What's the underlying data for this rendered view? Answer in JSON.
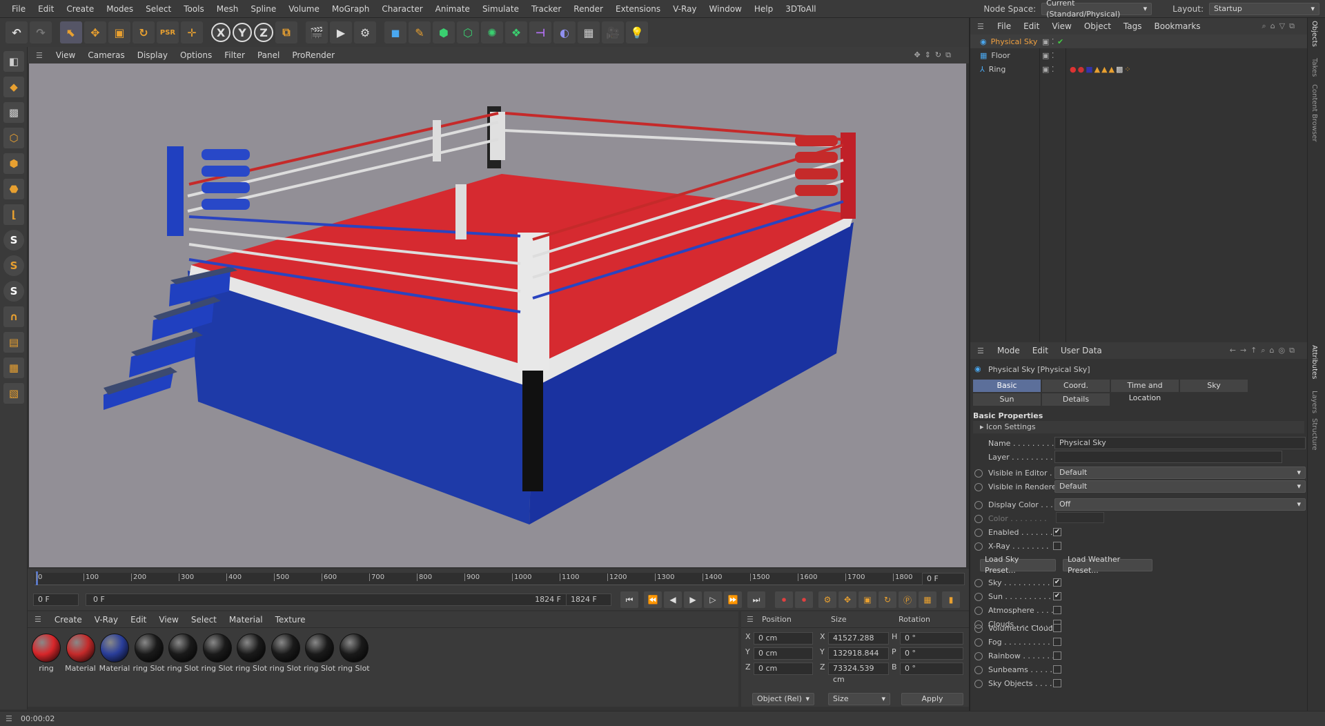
{
  "menubar": {
    "items": [
      "File",
      "Edit",
      "Create",
      "Modes",
      "Select",
      "Tools",
      "Mesh",
      "Spline",
      "Volume",
      "MoGraph",
      "Character",
      "Animate",
      "Simulate",
      "Tracker",
      "Render",
      "Extensions",
      "V-Ray",
      "Window",
      "Help",
      "3DToAll"
    ],
    "nodespace_label": "Node Space:",
    "nodespace_value": "Current (Standard/Physical)",
    "layout_label": "Layout:",
    "layout_value": "Startup"
  },
  "toolbar": {
    "axis_x": "X",
    "axis_y": "Y",
    "axis_z": "Z"
  },
  "viewport": {
    "menu": [
      "View",
      "Cameras",
      "Display",
      "Options",
      "Filter",
      "Panel",
      "ProRender"
    ]
  },
  "timeline": {
    "ticks": [
      "0",
      "100",
      "200",
      "300",
      "400",
      "500",
      "600",
      "700",
      "800",
      "900",
      "1000",
      "1100",
      "1200",
      "1300",
      "1400",
      "1500",
      "1600",
      "1700",
      "1800"
    ],
    "current": "0 F",
    "start": "0 F",
    "range_start": "0 F",
    "range_end": "1824 F",
    "end": "1824 F"
  },
  "materials": {
    "menu": [
      "Create",
      "V-Ray",
      "Edit",
      "View",
      "Select",
      "Material",
      "Texture"
    ],
    "items": [
      {
        "label": "ring",
        "color": "#d8262a"
      },
      {
        "label": "Material",
        "color": "#c52a2a"
      },
      {
        "label": "Material",
        "color": "#2a3e9a"
      },
      {
        "label": "ring Slot",
        "color": "#1a1a1a"
      },
      {
        "label": "ring Slot",
        "color": "#1a1a1a"
      },
      {
        "label": "ring Slot",
        "color": "#1a1a1a"
      },
      {
        "label": "ring Slot",
        "color": "#1a1a1a"
      },
      {
        "label": "ring Slot",
        "color": "#1a1a1a"
      },
      {
        "label": "ring Slot",
        "color": "#1a1a1a"
      },
      {
        "label": "ring Slot",
        "color": "#1a1a1a"
      }
    ]
  },
  "coords": {
    "h_position": "Position",
    "h_size": "Size",
    "h_rotation": "Rotation",
    "rows": [
      {
        "axis": "X",
        "pos": "0 cm",
        "saxis": "X",
        "size": "41527.288 cm",
        "raxis": "H",
        "rot": "0 °"
      },
      {
        "axis": "Y",
        "pos": "0 cm",
        "saxis": "Y",
        "size": "132918.844 cm",
        "raxis": "P",
        "rot": "0 °"
      },
      {
        "axis": "Z",
        "pos": "0 cm",
        "saxis": "Z",
        "size": "73324.539 cm",
        "raxis": "B",
        "rot": "0 °"
      }
    ],
    "mode": "Object (Rel)",
    "size_mode": "Size",
    "apply": "Apply"
  },
  "status": {
    "time": "00:00:02"
  },
  "objects": {
    "menu": [
      "File",
      "Edit",
      "View",
      "Object",
      "Tags",
      "Bookmarks"
    ],
    "items": [
      {
        "name": "Physical Sky"
      },
      {
        "name": "Floor"
      },
      {
        "name": "Ring"
      }
    ]
  },
  "attributes": {
    "menu": [
      "Mode",
      "Edit",
      "User Data"
    ],
    "title": "Physical Sky [Physical Sky]",
    "tabs": [
      "Basic",
      "Coord.",
      "Time and Location",
      "Sky",
      "Sun",
      "Details"
    ],
    "section": "Basic Properties",
    "icon_settings": "Icon Settings",
    "name_label": "Name . . . . . . . . .",
    "name_value": "Physical Sky",
    "layer_label": "Layer . . . . . . . . .",
    "vis_editor_label": "Visible in Editor . .",
    "vis_editor": "Default",
    "vis_render_label": "Visible in Renderer",
    "vis_render": "Default",
    "display_color_label": "Display Color . . . .",
    "display_color": "Off",
    "color_label": "Color . . . . . . . .",
    "enabled_label": "Enabled . . . . . . .",
    "xray_label": "X-Ray . . . . . . . .",
    "load_sky": "Load Sky Preset...",
    "load_weather": "Load Weather Preset...",
    "checks": [
      {
        "label": "Sky . . . . . . . . . .",
        "on": true
      },
      {
        "label": "Sun . . . . . . . . . .",
        "on": true
      },
      {
        "label": "Atmosphere . . . .",
        "on": false
      },
      {
        "label": "Clouds . . . . . . . .",
        "on": false
      },
      {
        "label": "Volumetric Clouds",
        "on": false
      },
      {
        "label": "Fog . . . . . . . . . .",
        "on": false
      },
      {
        "label": "Rainbow . . . . . . .",
        "on": false
      },
      {
        "label": "Sunbeams . . . . . .",
        "on": false
      },
      {
        "label": "Sky Objects . . . . .",
        "on": false
      }
    ]
  },
  "side_tabs": [
    "Objects",
    "Takes",
    "Content Browser",
    "Attributes",
    "Layers",
    "Structure"
  ]
}
